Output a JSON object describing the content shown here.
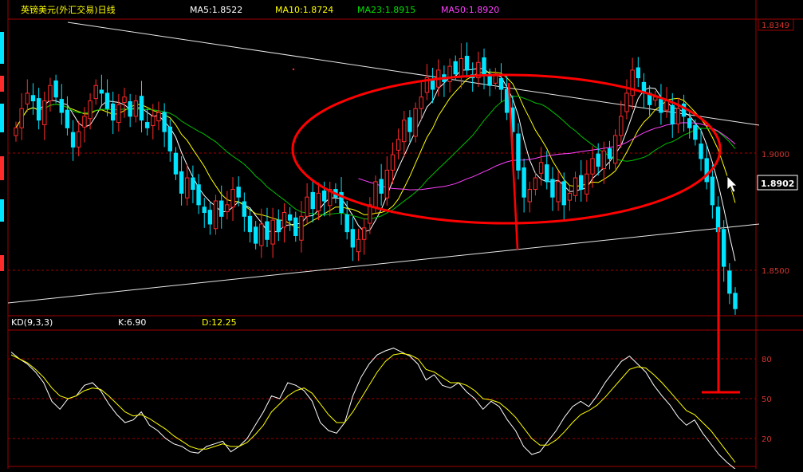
{
  "header": {
    "title": "英镑美元(外汇交易)日线",
    "ma5": "MA5:1.8522",
    "ma10": "MA10:1.8724",
    "ma23": "MA23:1.8915",
    "ma50": "MA50:1.8920"
  },
  "kd_header": {
    "name": "KD(9,3,3)",
    "k": "K:6.90",
    "d": "D:12.25"
  },
  "colors": {
    "up": "#ff2a2a",
    "down": "#00e5ff",
    "ma5": "#ffffff",
    "ma10": "#ffff00",
    "ma23": "#00c000",
    "ma50": "#ff40ff",
    "annotation": "#ff0000",
    "grid": "#a00000",
    "title": "#ffff00"
  },
  "chart_data": [
    {
      "type": "candlestick",
      "panel": "price",
      "ylim": [
        1.8168,
        1.8365
      ],
      "y_ticks": [
        "1.8349",
        "1.9000",
        "1.8500"
      ],
      "current_price": "1.8902",
      "closes": [
        1.896,
        1.901,
        1.905,
        1.903,
        1.898,
        1.903,
        1.907,
        1.904,
        1.9,
        1.896,
        1.891,
        1.895,
        1.899,
        1.903,
        1.907,
        1.905,
        1.901,
        1.898,
        1.902,
        1.904,
        1.899,
        1.903,
        1.898,
        1.896,
        1.899,
        1.9,
        1.895,
        1.89,
        1.884,
        1.879,
        1.883,
        1.88,
        1.876,
        1.874,
        1.871,
        1.877,
        1.873,
        1.876,
        1.88,
        1.878,
        1.873,
        1.869,
        1.866,
        1.871,
        1.867,
        1.872,
        1.869,
        1.874,
        1.872,
        1.868,
        1.873,
        1.878,
        1.875,
        1.879,
        1.877,
        1.88,
        1.878,
        1.874,
        1.869,
        1.865,
        1.867,
        1.87,
        1.876,
        1.882,
        1.879,
        1.885,
        1.889,
        1.893,
        1.898,
        1.895,
        1.901,
        1.904,
        1.909,
        1.906,
        1.911,
        1.908,
        1.912,
        1.91,
        1.914,
        1.911,
        1.909,
        1.913,
        1.91,
        1.907,
        1.91,
        1.906,
        1.9,
        1.895,
        1.885,
        1.878,
        1.88,
        1.883,
        1.887,
        1.882,
        1.878,
        1.882,
        1.876,
        1.879,
        1.883,
        1.88,
        1.884,
        1.888,
        1.886,
        1.89,
        1.888,
        1.894,
        1.899,
        1.905,
        1.911,
        1.909,
        1.905,
        1.902,
        1.904,
        1.9,
        1.903,
        1.897,
        1.901,
        1.899,
        1.896,
        1.893,
        1.888,
        1.882,
        1.876,
        1.869,
        1.86,
        1.853,
        1.849
      ]
    },
    {
      "type": "line",
      "panel": "kd",
      "title": "KD(9,3,3)",
      "ylim": [
        0,
        100
      ],
      "y_ticks": [
        "80",
        "50",
        "20"
      ],
      "series": [
        {
          "name": "K",
          "values": [
            95,
            90,
            86,
            80,
            72,
            58,
            52,
            60,
            62,
            70,
            72,
            66,
            56,
            48,
            42,
            44,
            50,
            40,
            36,
            30,
            26,
            24,
            20,
            19,
            24,
            26,
            28,
            20,
            24,
            30,
            40,
            50,
            62,
            60,
            72,
            70,
            66,
            58,
            42,
            36,
            34,
            42,
            62,
            76,
            86,
            93,
            96,
            98,
            95,
            92,
            86,
            74,
            78,
            70,
            68,
            72,
            65,
            60,
            52,
            58,
            54,
            44,
            36,
            24,
            18,
            20,
            28,
            36,
            46,
            54,
            58,
            54,
            62,
            72,
            80,
            88,
            92,
            86,
            80,
            70,
            62,
            55,
            46,
            40,
            44,
            34,
            26,
            18,
            12,
            7
          ]
        },
        {
          "name": "D",
          "values": [
            93,
            90,
            87,
            82,
            76,
            68,
            62,
            60,
            62,
            66,
            68,
            67,
            62,
            56,
            50,
            47,
            48,
            45,
            41,
            37,
            32,
            28,
            24,
            22,
            22,
            24,
            26,
            24,
            24,
            27,
            33,
            40,
            50,
            56,
            62,
            66,
            68,
            64,
            56,
            48,
            42,
            42,
            50,
            60,
            70,
            80,
            88,
            93,
            94,
            93,
            90,
            82,
            80,
            76,
            72,
            72,
            70,
            66,
            60,
            59,
            57,
            52,
            46,
            38,
            30,
            25,
            25,
            29,
            35,
            42,
            48,
            51,
            55,
            61,
            68,
            75,
            82,
            84,
            83,
            78,
            72,
            65,
            58,
            51,
            48,
            42,
            36,
            28,
            20,
            12
          ]
        }
      ]
    }
  ]
}
